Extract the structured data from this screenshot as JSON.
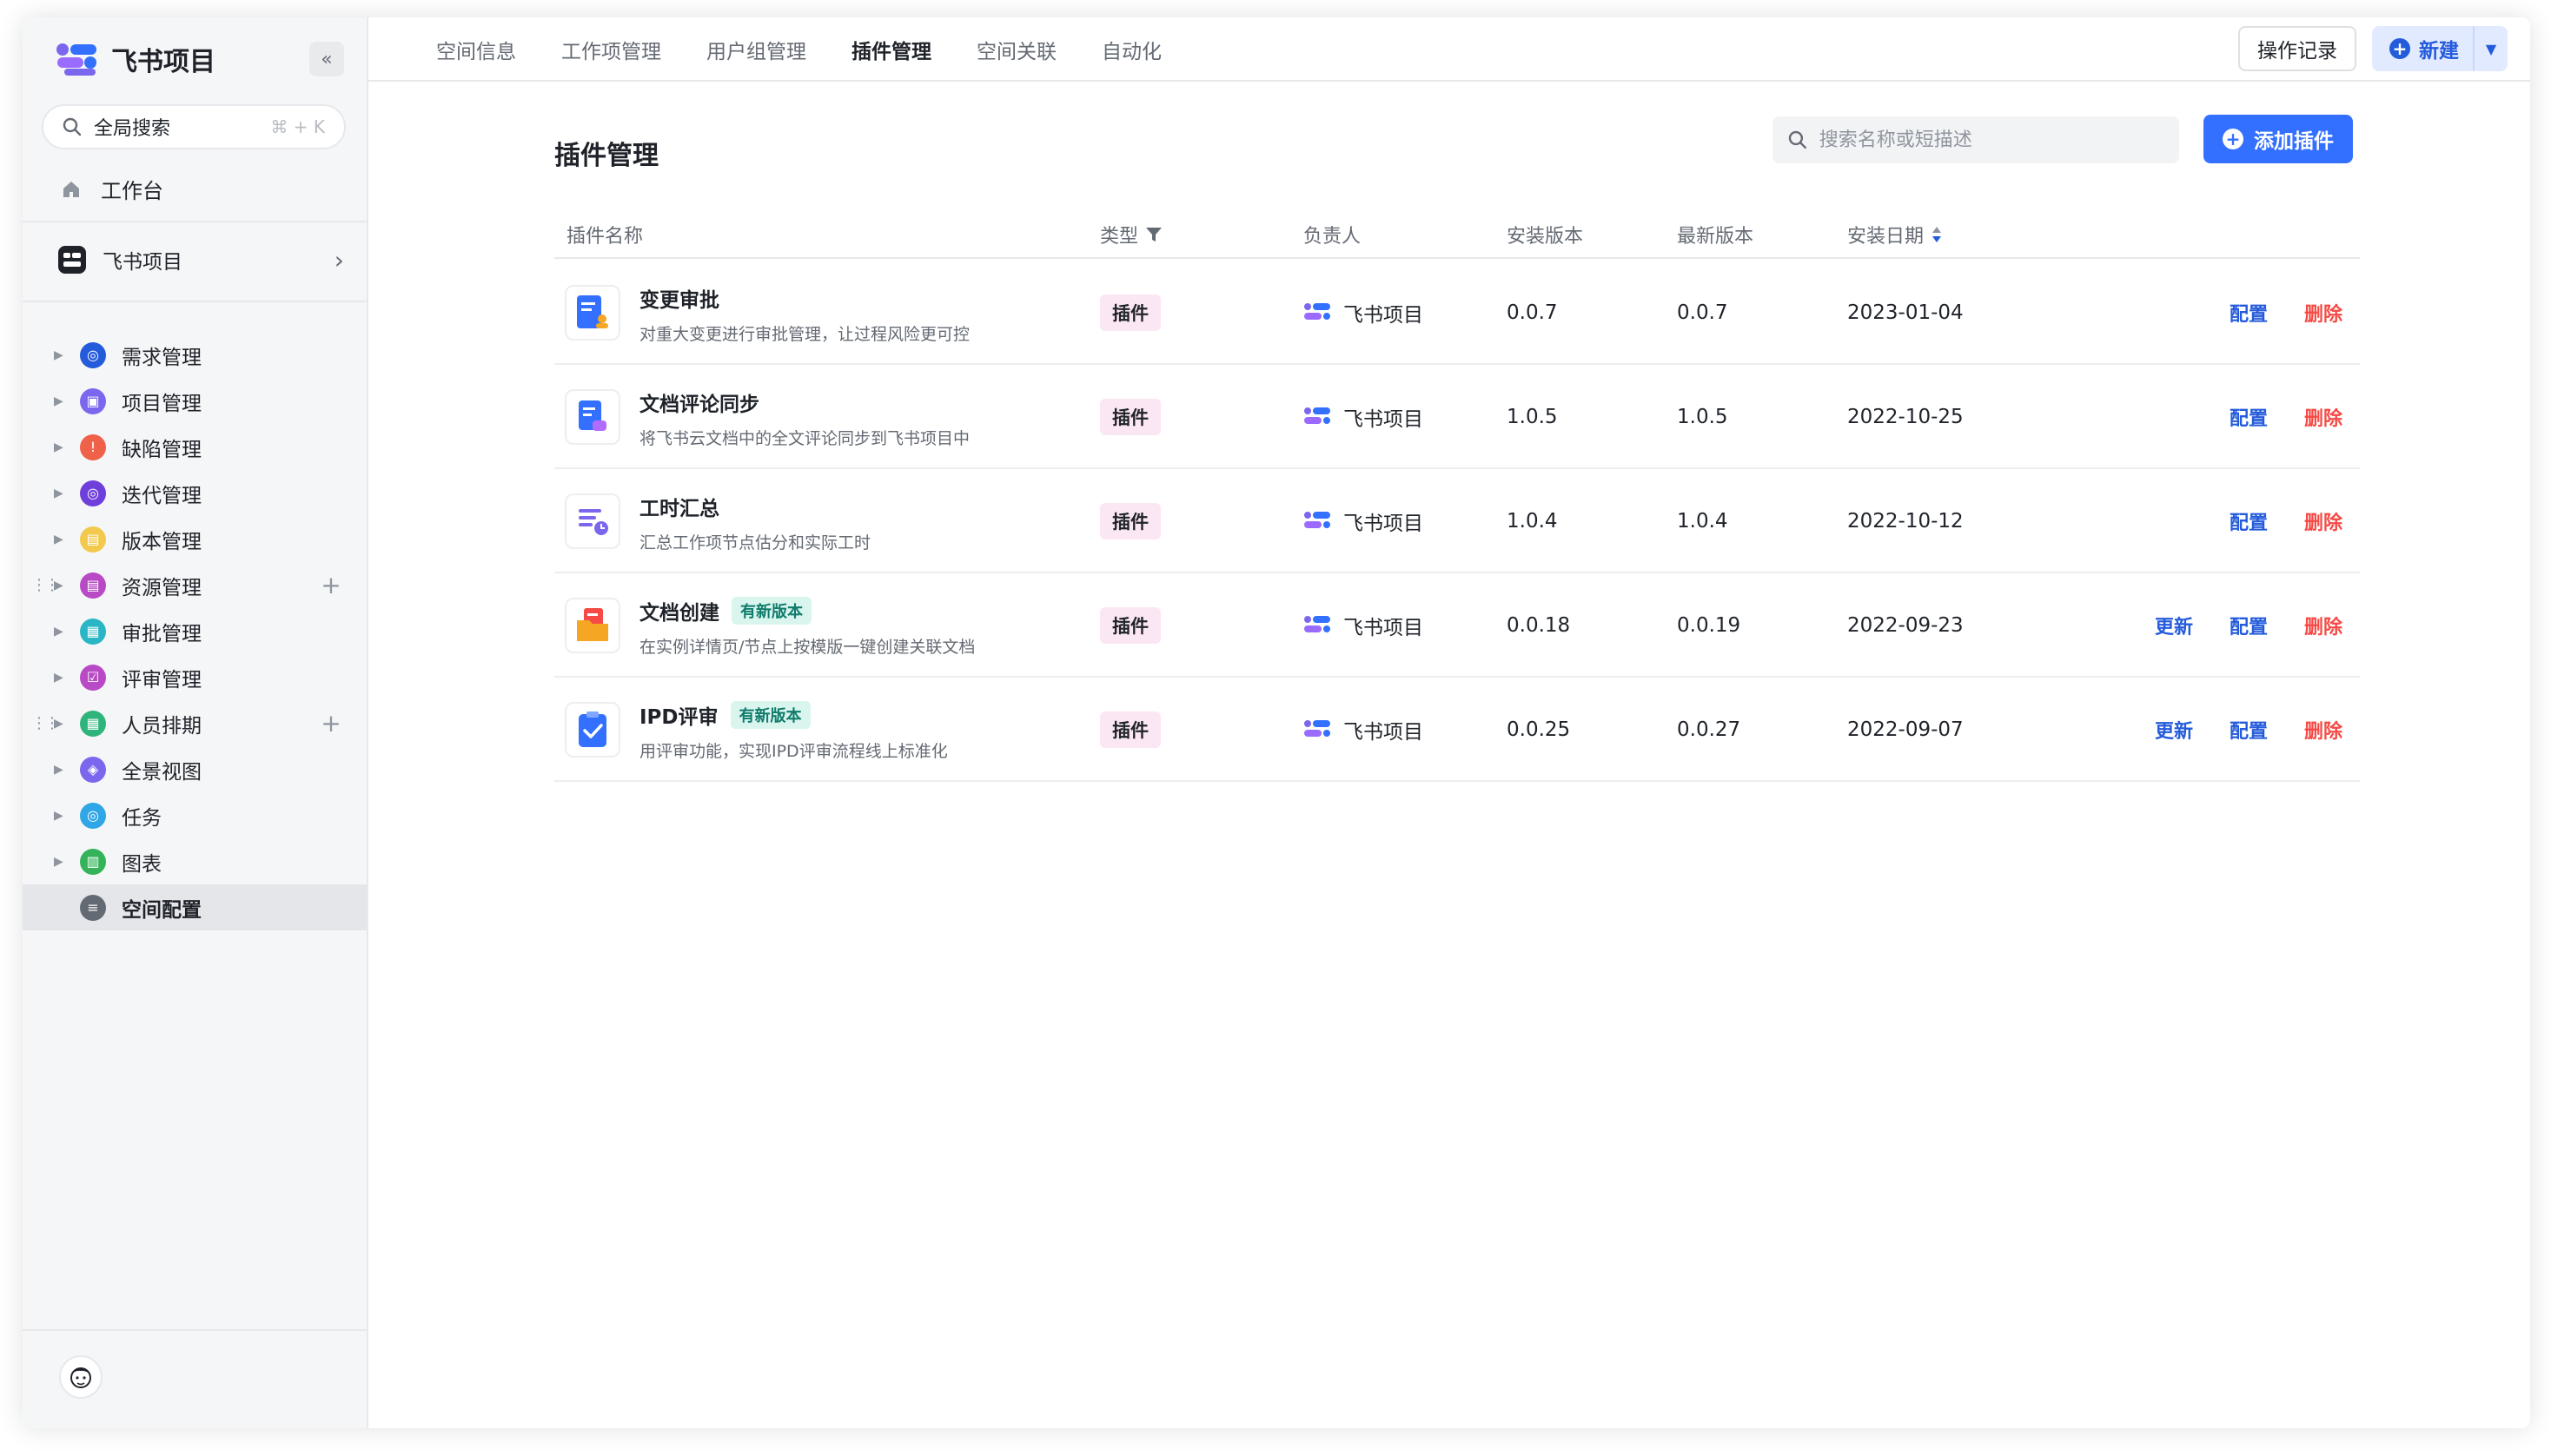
{
  "app": {
    "brand": "飞书项目",
    "collapse_icon": "«",
    "search_label": "全局搜索",
    "search_shortcut": "⌘ + K",
    "home_label": "工作台",
    "space_name": "飞书项目"
  },
  "sidebar": {
    "items": [
      {
        "label": "需求管理",
        "color": "#245bdb",
        "icon": "◎",
        "draggable": false,
        "addable": false
      },
      {
        "label": "项目管理",
        "color": "#7b67ee",
        "icon": "▣",
        "draggable": false,
        "addable": false
      },
      {
        "label": "缺陷管理",
        "color": "#f0614a",
        "icon": "!",
        "draggable": false,
        "addable": false
      },
      {
        "label": "迭代管理",
        "color": "#6f3fdb",
        "icon": "◎",
        "draggable": false,
        "addable": false
      },
      {
        "label": "版本管理",
        "color": "#f2c94c",
        "icon": "▤",
        "draggable": false,
        "addable": false
      },
      {
        "label": "资源管理",
        "color": "#b84ac6",
        "icon": "▤",
        "draggable": true,
        "addable": true
      },
      {
        "label": "审批管理",
        "color": "#2ab6c5",
        "icon": "▦",
        "draggable": false,
        "addable": false
      },
      {
        "label": "评审管理",
        "color": "#b84ac6",
        "icon": "☑",
        "draggable": false,
        "addable": false
      },
      {
        "label": "人员排期",
        "color": "#2fb47c",
        "icon": "▦",
        "draggable": true,
        "addable": true
      },
      {
        "label": "全景视图",
        "color": "#7b67ee",
        "icon": "◈",
        "draggable": false,
        "addable": false
      },
      {
        "label": "任务",
        "color": "#2fa6e6",
        "icon": "◎",
        "draggable": false,
        "addable": false
      },
      {
        "label": "图表",
        "color": "#34b35a",
        "icon": "▥",
        "draggable": false,
        "addable": false
      },
      {
        "label": "空间配置",
        "color": "#646a73",
        "icon": "≡",
        "draggable": false,
        "addable": false,
        "active": true
      }
    ]
  },
  "topnav": {
    "tabs": [
      "空间信息",
      "工作项管理",
      "用户组管理",
      "插件管理",
      "空间关联",
      "自动化"
    ],
    "active_tab": 3,
    "log_button": "操作记录",
    "new_button": "新建"
  },
  "page": {
    "title": "插件管理",
    "search_placeholder": "搜索名称或短描述",
    "add_button": "添加插件",
    "columns": [
      "插件名称",
      "类型",
      "负责人",
      "安装版本",
      "最新版本",
      "安装日期"
    ]
  },
  "plugins": [
    {
      "name": "变更审批",
      "desc": "对重大变更进行审批管理，让过程风险更可控",
      "has_new": false,
      "type": "插件",
      "owner": "飞书项目",
      "installed": "0.0.7",
      "latest": "0.0.7",
      "date": "2023-01-04",
      "update": "",
      "config": "配置",
      "delete": "删除",
      "icon_color": "#3370ff"
    },
    {
      "name": "文档评论同步",
      "desc": "将飞书云文档中的全文评论同步到飞书项目中",
      "has_new": false,
      "type": "插件",
      "owner": "飞书项目",
      "installed": "1.0.5",
      "latest": "1.0.5",
      "date": "2022-10-25",
      "update": "",
      "config": "配置",
      "delete": "删除",
      "icon_color": "#3370ff"
    },
    {
      "name": "工时汇总",
      "desc": "汇总工作项节点估分和实际工时",
      "has_new": false,
      "type": "插件",
      "owner": "飞书项目",
      "installed": "1.0.4",
      "latest": "1.0.4",
      "date": "2022-10-12",
      "update": "",
      "config": "配置",
      "delete": "删除",
      "icon_color": "#7b67ee"
    },
    {
      "name": "文档创建",
      "desc": "在实例详情页/节点上按模版一键创建关联文档",
      "has_new": true,
      "new_tag": "有新版本",
      "type": "插件",
      "owner": "飞书项目",
      "installed": "0.0.18",
      "latest": "0.0.19",
      "date": "2022-09-23",
      "update": "更新",
      "config": "配置",
      "delete": "删除",
      "icon_color": "#f5a623"
    },
    {
      "name": "IPD评审",
      "desc": "用评审功能，实现IPD评审流程线上标准化",
      "has_new": true,
      "new_tag": "有新版本",
      "type": "插件",
      "owner": "飞书项目",
      "installed": "0.0.25",
      "latest": "0.0.27",
      "date": "2022-09-07",
      "update": "更新",
      "config": "配置",
      "delete": "删除",
      "icon_color": "#3370ff"
    }
  ],
  "help": {
    "label": "帮助"
  },
  "colors": {
    "accent": "#3370ff",
    "danger": "#f54a45",
    "brand_purple": "#7b67ee"
  }
}
